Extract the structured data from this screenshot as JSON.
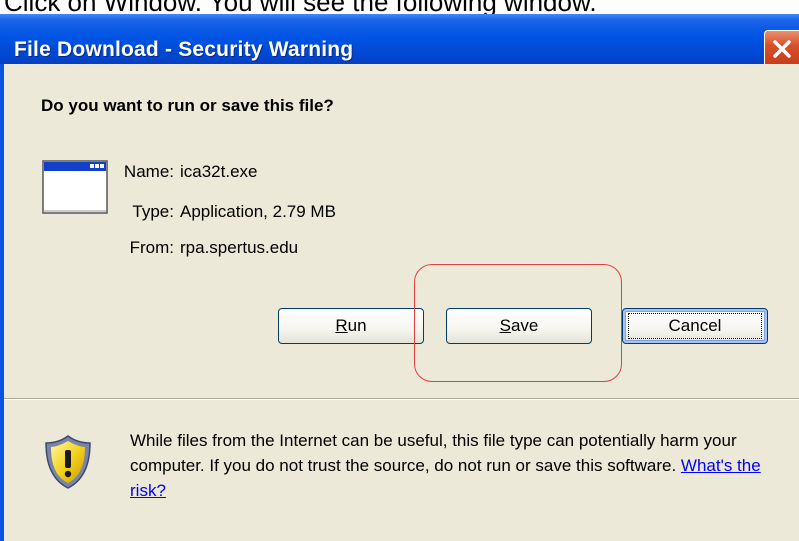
{
  "caption": "Click on Window. You will see the following window.",
  "window": {
    "title": "File Download - Security Warning",
    "close_icon": "close-icon"
  },
  "dialog": {
    "question": "Do you want to run or save this file?",
    "file_icon": "application-window-icon",
    "fields": {
      "name_label": "Name:",
      "name_value": "ica32t.exe",
      "type_label": "Type:",
      "type_value": "Application, 2.79 MB",
      "from_label": "From:",
      "from_value": "rpa.spertus.edu"
    },
    "buttons": {
      "run_mnemonic": "R",
      "run_rest": "un",
      "save_mnemonic": "S",
      "save_rest": "ave",
      "cancel": "Cancel"
    },
    "warning": {
      "icon": "shield-warning-icon",
      "text": "While files from the Internet can be useful, this file type can potentially harm your computer. If you do not trust the source, do not run or save this software. ",
      "link": "What's the risk?"
    }
  },
  "colors": {
    "titlebar": "#0055E5",
    "dialog_bg": "#ECE9D8",
    "close_button": "#D9512A",
    "highlight": "#E04040",
    "link": "#0000FF"
  }
}
